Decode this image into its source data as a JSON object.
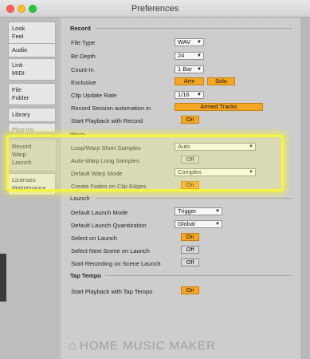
{
  "window": {
    "title": "Preferences"
  },
  "sidebar": {
    "tabs": [
      {
        "lines": [
          "Look",
          "Feel"
        ]
      },
      {
        "lines": [
          "Audio"
        ]
      },
      {
        "lines": [
          "Link",
          "MIDI"
        ]
      },
      {
        "lines": [
          "File",
          "Folder"
        ]
      },
      {
        "lines": [
          "Library"
        ]
      },
      {
        "lines": [
          "Plug-Ins"
        ]
      },
      {
        "lines": [
          "Record",
          "Warp",
          "Launch"
        ]
      },
      {
        "lines": [
          "Licenses",
          "Maintenance"
        ]
      }
    ]
  },
  "record": {
    "heading": "Record",
    "file_type": {
      "label": "File Type",
      "value": "WAV"
    },
    "bit_depth": {
      "label": "Bit Depth",
      "value": "24"
    },
    "count_in": {
      "label": "Count-In",
      "value": "1 Bar"
    },
    "exclusive": {
      "label": "Exclusive",
      "arm": "Arm",
      "solo": "Solo"
    },
    "clip_update_rate": {
      "label": "Clip Update Rate",
      "value": "1/16"
    },
    "record_session_automation": {
      "label": "Record Session automation in",
      "value": "Armed Tracks"
    },
    "start_playback_with_record": {
      "label": "Start Playback with Record",
      "value": "On"
    }
  },
  "warp": {
    "heading": "Warp",
    "loop_warp_short": {
      "label": "Loop/Warp Short Samples",
      "value": "Auto"
    },
    "auto_warp_long": {
      "label": "Auto-Warp Long Samples",
      "value": "Off"
    },
    "default_warp_mode": {
      "label": "Default Warp Mode",
      "value": "Complex"
    },
    "create_fades": {
      "label": "Create Fades on Clip Edges",
      "value": "On"
    }
  },
  "launch": {
    "heading": "Launch",
    "default_launch_mode": {
      "label": "Default Launch Mode",
      "value": "Trigger"
    },
    "default_launch_quantization": {
      "label": "Default Launch Quantization",
      "value": "Global"
    },
    "select_on_launch": {
      "label": "Select on Launch",
      "value": "On"
    },
    "select_next_scene": {
      "label": "Select Next Scene on Launch",
      "value": "Off"
    },
    "start_recording_scene": {
      "label": "Start Recording on Scene Launch",
      "value": "Off"
    }
  },
  "tap_tempo": {
    "heading": "Tap Tempo",
    "start_playback_tap": {
      "label": "Start Playback with Tap Tempo",
      "value": "On"
    }
  },
  "watermark": {
    "text": "HOME MUSIC MAKER"
  },
  "colors": {
    "accent_on": "#f5a623",
    "highlight": "#f6f53b"
  }
}
